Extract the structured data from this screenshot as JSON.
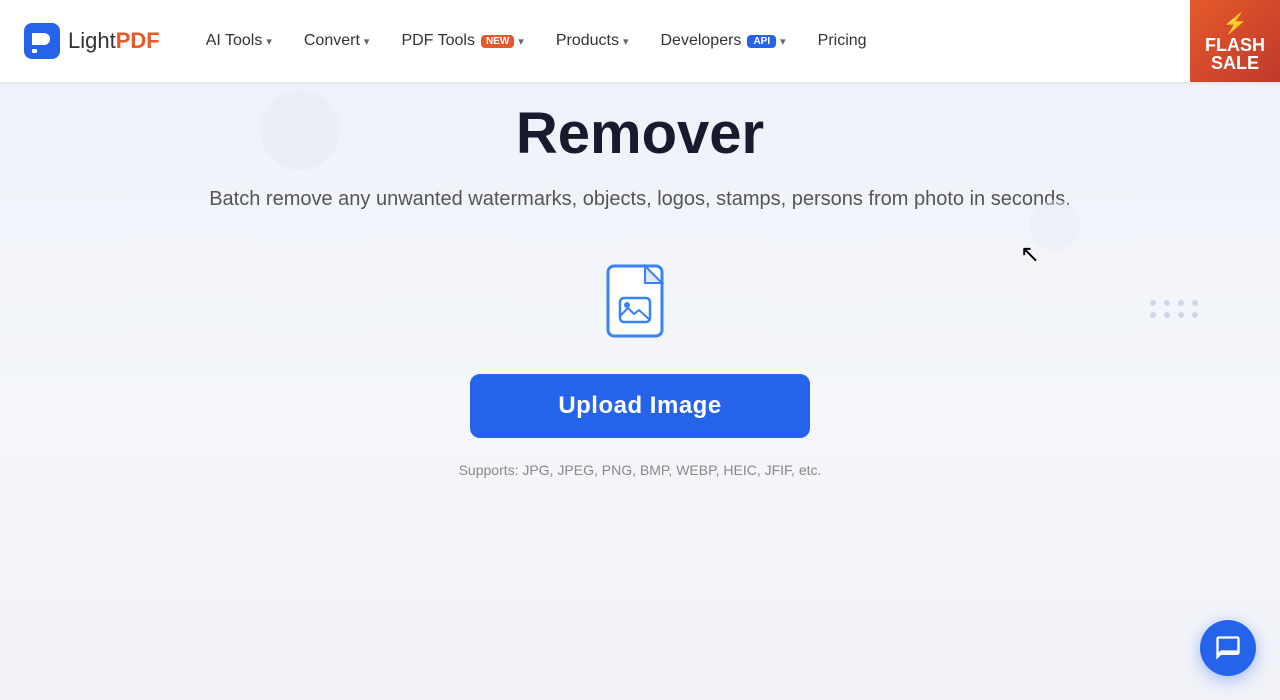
{
  "nav": {
    "logo_light": "Light",
    "logo_pdf": "PDF",
    "items": [
      {
        "label": "AI Tools",
        "has_chevron": true,
        "badge": null
      },
      {
        "label": "Convert",
        "has_chevron": true,
        "badge": null
      },
      {
        "label": "PDF Tools",
        "has_chevron": true,
        "badge": "NEW"
      },
      {
        "label": "Products",
        "has_chevron": true,
        "badge": null
      },
      {
        "label": "Developers",
        "has_chevron": true,
        "badge": "API"
      },
      {
        "label": "Pricing",
        "has_chevron": false,
        "badge": null
      }
    ],
    "flash_sale_line1": "FLASH",
    "flash_sale_line2": "SALE"
  },
  "main": {
    "title": "Remover",
    "subtitle": "Batch remove any unwanted watermarks, objects, logos, stamps, persons from photo in seconds.",
    "upload_button_label": "Upload Image",
    "supported_label": "Supports: JPG, JPEG, PNG, BMP, WEBP, HEIC, JFIF, etc."
  }
}
